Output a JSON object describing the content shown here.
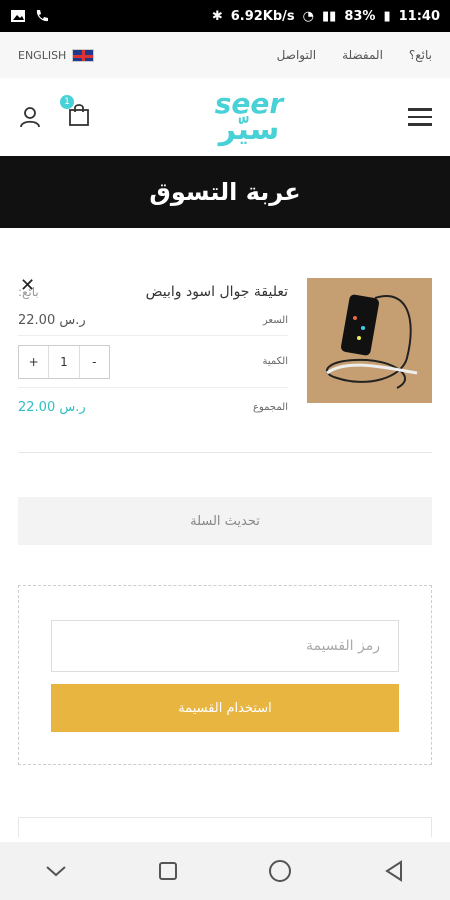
{
  "status": {
    "speed": "6.92Kb/s",
    "battery": "83%",
    "time": "11:40"
  },
  "topbar": {
    "language": "ENGLISH",
    "links": [
      "التواصل",
      "المفضلة",
      "بائع؟"
    ]
  },
  "header": {
    "cart_count": "1",
    "logo_en": "seer",
    "logo_ar": "سيّر"
  },
  "page": {
    "title": "عربة التسوق"
  },
  "cart_item": {
    "name": "تعليقة جوال اسود وابيض",
    "seller_label": "بائع:",
    "price_label": "السعر",
    "price_value": "22.00 ر.س",
    "qty_label": "الكمية",
    "qty_minus": "-",
    "qty_value": "1",
    "qty_plus": "+",
    "total_label": "المجموع",
    "total_value": "22.00 ر.س"
  },
  "actions": {
    "update_cart": "تحديث السلة"
  },
  "coupon": {
    "placeholder": "رمز القسيمة",
    "apply_label": "استخدام القسيمة"
  }
}
